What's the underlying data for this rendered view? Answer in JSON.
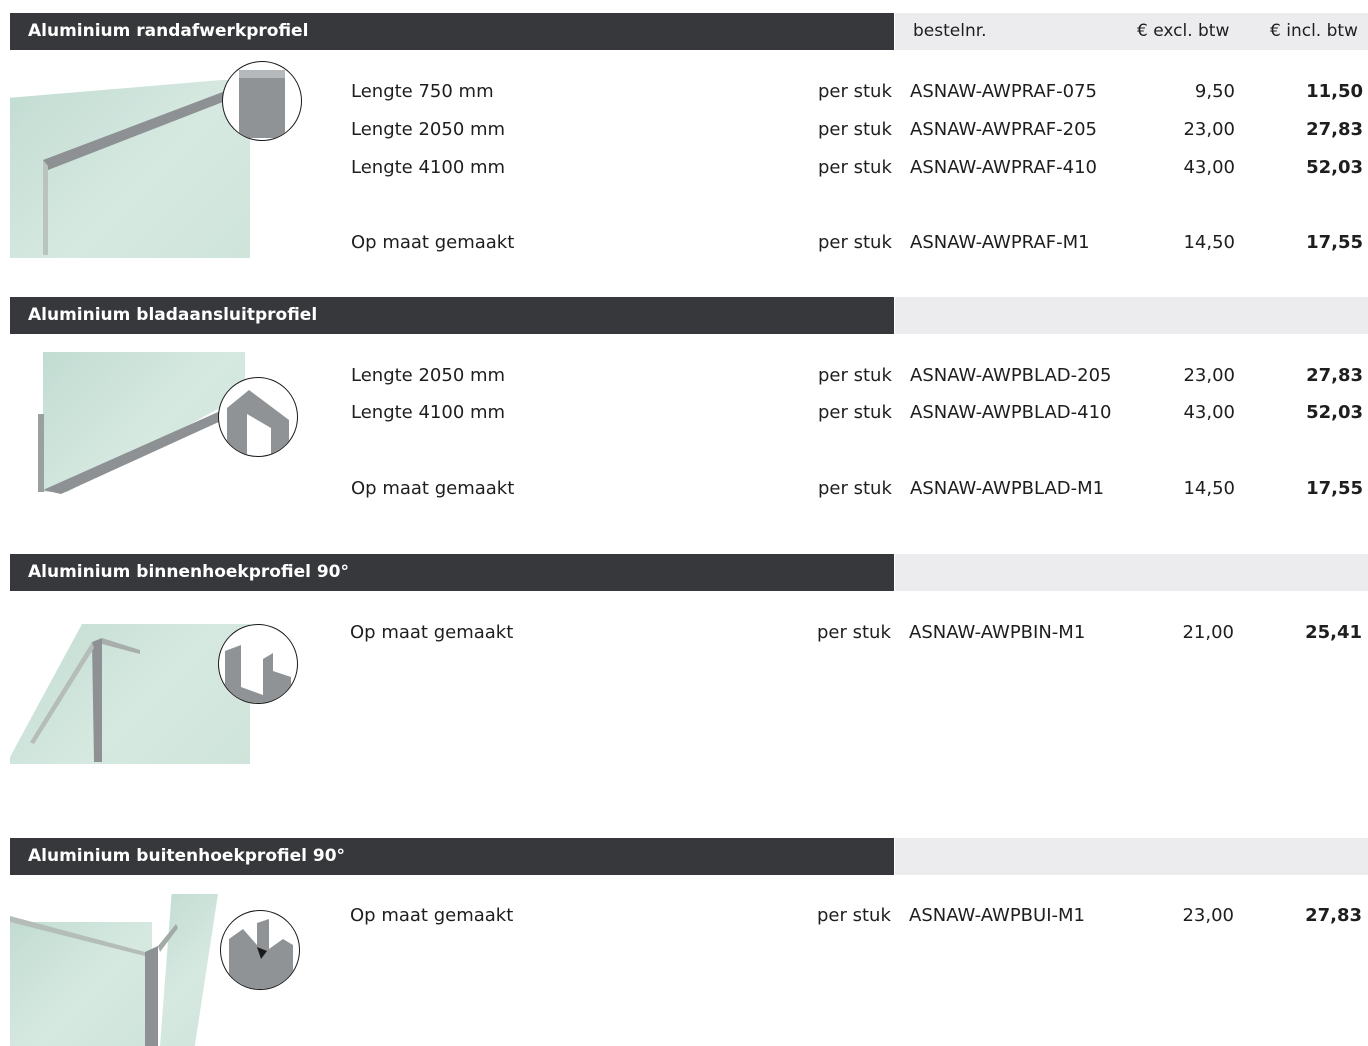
{
  "column_headers": {
    "order_no": "bestelnr.",
    "price_excl": "€ excl. btw",
    "price_incl": "€ incl. btw"
  },
  "sections": [
    {
      "title": "Aluminium randafwerkprofiel",
      "rows": [
        {
          "desc": "Lengte 750 mm",
          "unit": "per stuk",
          "code": "ASNAW-AWPRAF-075",
          "excl": "9,50",
          "incl": "11,50"
        },
        {
          "desc": "Lengte 2050 mm",
          "unit": "per stuk",
          "code": "ASNAW-AWPRAF-205",
          "excl": "23,00",
          "incl": "27,83"
        },
        {
          "desc": "Lengte 4100 mm",
          "unit": "per stuk",
          "code": "ASNAW-AWPRAF-410",
          "excl": "43,00",
          "incl": "52,03"
        },
        {
          "desc": "Op maat gemaakt",
          "unit": "per stuk",
          "code": "ASNAW-AWPRAF-M1",
          "excl": "14,50",
          "incl": "17,55"
        }
      ]
    },
    {
      "title": "Aluminium bladaansluitprofiel",
      "rows": [
        {
          "desc": "Lengte 2050 mm",
          "unit": "per stuk",
          "code": "ASNAW-AWPBLAD-205",
          "excl": "23,00",
          "incl": "27,83"
        },
        {
          "desc": "Lengte 4100 mm",
          "unit": "per stuk",
          "code": "ASNAW-AWPBLAD-410",
          "excl": "43,00",
          "incl": "52,03"
        },
        {
          "desc": "Op maat gemaakt",
          "unit": "per stuk",
          "code": "ASNAW-AWPBLAD-M1",
          "excl": "14,50",
          "incl": "17,55"
        }
      ]
    },
    {
      "title": "Aluminium binnenhoekprofiel 90°",
      "rows": [
        {
          "desc": "Op maat gemaakt",
          "unit": "per stuk",
          "code": "ASNAW-AWPBIN-M1",
          "excl": "21,00",
          "incl": "25,41"
        }
      ]
    },
    {
      "title": "Aluminium buitenhoekprofiel 90°",
      "rows": [
        {
          "desc": "Op maat gemaakt",
          "unit": "per stuk",
          "code": "ASNAW-AWPBUI-M1",
          "excl": "23,00",
          "incl": "27,83"
        }
      ]
    }
  ],
  "colors": {
    "header_dark": "#36383b",
    "header_light": "#ececef",
    "glass": "#cfe4da",
    "profile": "#8d9193"
  },
  "icons": [
    "edge-profile-icon",
    "blade-connector-profile-icon",
    "inner-corner-profile-icon",
    "outer-corner-profile-icon"
  ]
}
